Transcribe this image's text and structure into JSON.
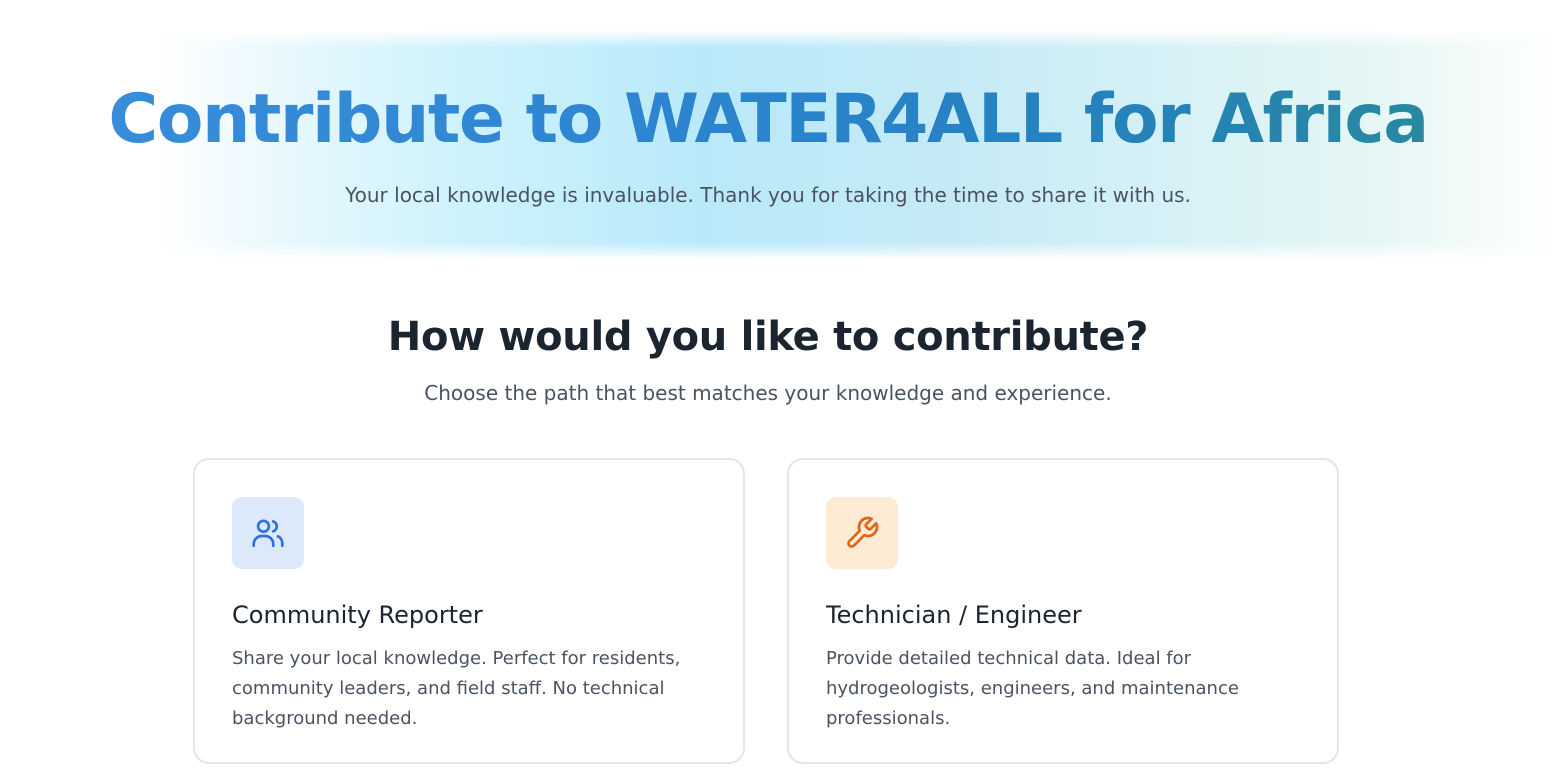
{
  "hero": {
    "title": "Contribute to WATER4ALL for Africa",
    "subtitle": "Your local knowledge is invaluable. Thank you for taking the time to share it with us."
  },
  "section": {
    "title": "How would you like to contribute?",
    "subtitle": "Choose the path that best matches your knowledge and experience."
  },
  "cards": [
    {
      "icon": "users-icon",
      "accent": "#2f6fde",
      "icon_bg": "#dce9fb",
      "title": "Community Reporter",
      "description": "Share your local knowledge. Perfect for residents, community leaders, and field staff. No technical background needed."
    },
    {
      "icon": "wrench-icon",
      "accent": "#e0661a",
      "icon_bg": "#fdebd3",
      "title": "Technician / Engineer",
      "description": "Provide detailed technical data. Ideal for hydrogeologists, engineers, and maintenance professionals."
    }
  ]
}
